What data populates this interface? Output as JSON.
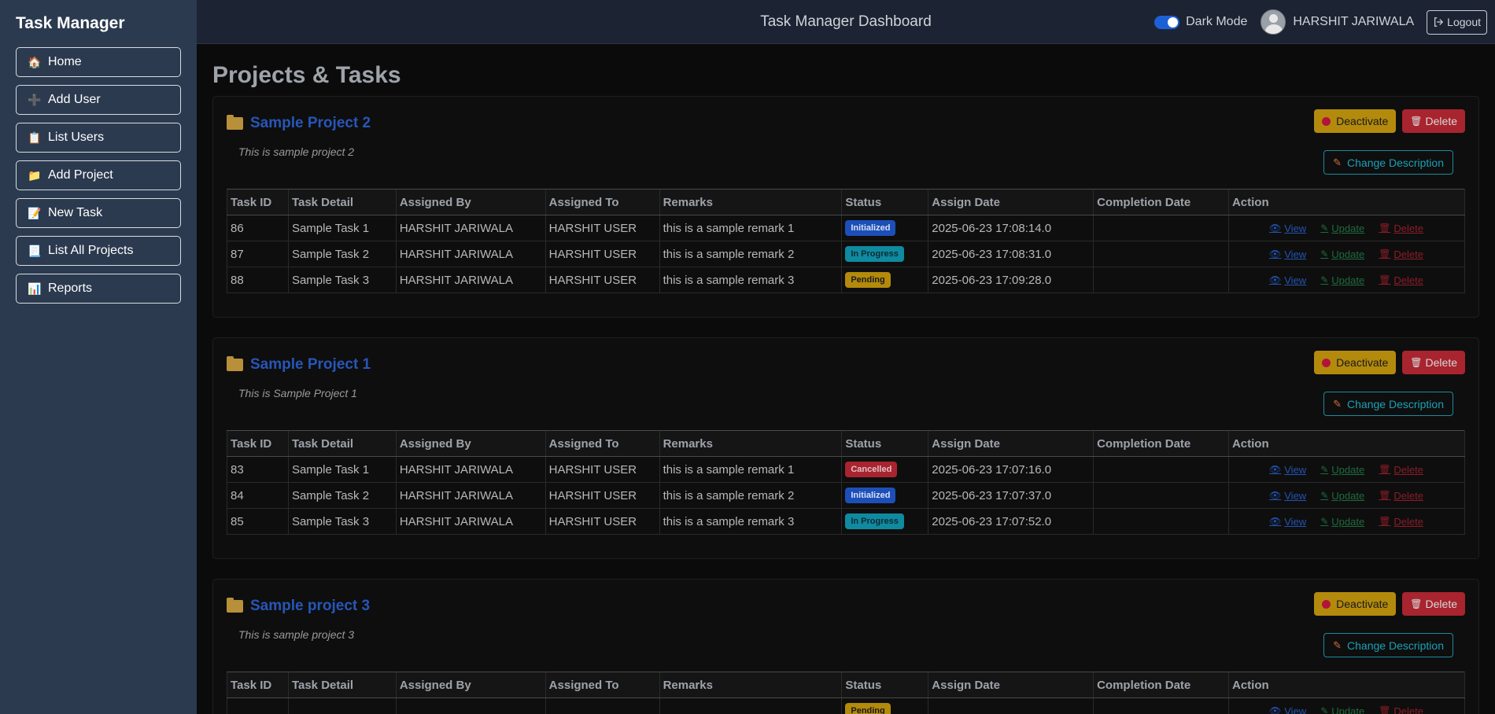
{
  "sidebar": {
    "brand": "Task Manager",
    "items": [
      {
        "label": "Home",
        "icon": "🏠"
      },
      {
        "label": "Add User",
        "icon": "➕"
      },
      {
        "label": "List Users",
        "icon": "📋"
      },
      {
        "label": "Add Project",
        "icon": "📁"
      },
      {
        "label": "New Task",
        "icon": "📝"
      },
      {
        "label": "List All Projects",
        "icon": "📃"
      },
      {
        "label": "Reports",
        "icon": "📊"
      }
    ]
  },
  "header": {
    "title": "Task Manager Dashboard",
    "dark_mode_label": "Dark Mode",
    "user_name": "HARSHIT JARIWALA",
    "logout_label": "Logout"
  },
  "main": {
    "title": "Projects & Tasks",
    "buttons": {
      "deactivate": "Deactivate",
      "delete": "Delete",
      "change_description": "Change Description",
      "view": "View",
      "update": "Update",
      "delete_task": "Delete"
    },
    "columns": [
      "Task ID",
      "Task Detail",
      "Assigned By",
      "Assigned To",
      "Remarks",
      "Status",
      "Assign Date",
      "Completion Date",
      "Action"
    ],
    "projects": [
      {
        "name": "Sample Project 2",
        "description": "This is sample project 2",
        "tasks": [
          {
            "id": "86",
            "detail": "Sample Task 1",
            "by": "HARSHIT JARIWALA",
            "to": "HARSHIT USER",
            "remarks": "this is a sample remark 1",
            "status": "Initialized",
            "assign_date": "2025-06-23 17:08:14.0",
            "completion_date": ""
          },
          {
            "id": "87",
            "detail": "Sample Task 2",
            "by": "HARSHIT JARIWALA",
            "to": "HARSHIT USER",
            "remarks": "this is a sample remark 2",
            "status": "In Progress",
            "assign_date": "2025-06-23 17:08:31.0",
            "completion_date": ""
          },
          {
            "id": "88",
            "detail": "Sample Task 3",
            "by": "HARSHIT JARIWALA",
            "to": "HARSHIT USER",
            "remarks": "this is a sample remark 3",
            "status": "Pending",
            "assign_date": "2025-06-23 17:09:28.0",
            "completion_date": ""
          }
        ]
      },
      {
        "name": "Sample Project 1",
        "description": "This is Sample Project 1",
        "tasks": [
          {
            "id": "83",
            "detail": "Sample Task 1",
            "by": "HARSHIT JARIWALA",
            "to": "HARSHIT USER",
            "remarks": "this is a sample remark 1",
            "status": "Cancelled",
            "assign_date": "2025-06-23 17:07:16.0",
            "completion_date": ""
          },
          {
            "id": "84",
            "detail": "Sample Task 2",
            "by": "HARSHIT JARIWALA",
            "to": "HARSHIT USER",
            "remarks": "this is a sample remark 2",
            "status": "Initialized",
            "assign_date": "2025-06-23 17:07:37.0",
            "completion_date": ""
          },
          {
            "id": "85",
            "detail": "Sample Task 3",
            "by": "HARSHIT JARIWALA",
            "to": "HARSHIT USER",
            "remarks": "this is a sample remark 3",
            "status": "In Progress",
            "assign_date": "2025-06-23 17:07:52.0",
            "completion_date": ""
          }
        ]
      },
      {
        "name": "Sample project 3",
        "description": "This is sample project 3",
        "tasks": [
          {
            "id": "",
            "detail": "",
            "by": "",
            "to": "",
            "remarks": "",
            "status": "Pending",
            "assign_date": "",
            "completion_date": ""
          }
        ]
      }
    ]
  },
  "colors": {
    "sidebar_bg": "#2b3a4f",
    "topbar_bg": "#1c2433",
    "page_bg": "#0b0b0b",
    "project_title": "#2756b8",
    "deactivate": "#b38a0c",
    "delete": "#a8242f",
    "info": "#1aa0b8"
  }
}
